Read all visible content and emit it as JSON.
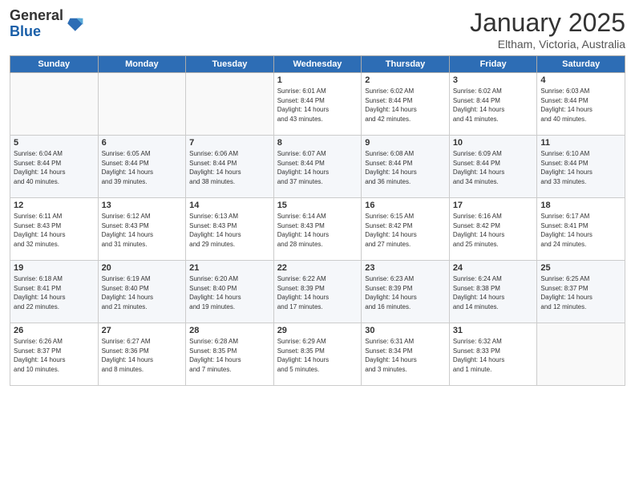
{
  "logo": {
    "general": "General",
    "blue": "Blue"
  },
  "header": {
    "month": "January 2025",
    "location": "Eltham, Victoria, Australia"
  },
  "weekdays": [
    "Sunday",
    "Monday",
    "Tuesday",
    "Wednesday",
    "Thursday",
    "Friday",
    "Saturday"
  ],
  "weeks": [
    [
      {
        "day": "",
        "info": ""
      },
      {
        "day": "",
        "info": ""
      },
      {
        "day": "",
        "info": ""
      },
      {
        "day": "1",
        "info": "Sunrise: 6:01 AM\nSunset: 8:44 PM\nDaylight: 14 hours\nand 43 minutes."
      },
      {
        "day": "2",
        "info": "Sunrise: 6:02 AM\nSunset: 8:44 PM\nDaylight: 14 hours\nand 42 minutes."
      },
      {
        "day": "3",
        "info": "Sunrise: 6:02 AM\nSunset: 8:44 PM\nDaylight: 14 hours\nand 41 minutes."
      },
      {
        "day": "4",
        "info": "Sunrise: 6:03 AM\nSunset: 8:44 PM\nDaylight: 14 hours\nand 40 minutes."
      }
    ],
    [
      {
        "day": "5",
        "info": "Sunrise: 6:04 AM\nSunset: 8:44 PM\nDaylight: 14 hours\nand 40 minutes."
      },
      {
        "day": "6",
        "info": "Sunrise: 6:05 AM\nSunset: 8:44 PM\nDaylight: 14 hours\nand 39 minutes."
      },
      {
        "day": "7",
        "info": "Sunrise: 6:06 AM\nSunset: 8:44 PM\nDaylight: 14 hours\nand 38 minutes."
      },
      {
        "day": "8",
        "info": "Sunrise: 6:07 AM\nSunset: 8:44 PM\nDaylight: 14 hours\nand 37 minutes."
      },
      {
        "day": "9",
        "info": "Sunrise: 6:08 AM\nSunset: 8:44 PM\nDaylight: 14 hours\nand 36 minutes."
      },
      {
        "day": "10",
        "info": "Sunrise: 6:09 AM\nSunset: 8:44 PM\nDaylight: 14 hours\nand 34 minutes."
      },
      {
        "day": "11",
        "info": "Sunrise: 6:10 AM\nSunset: 8:44 PM\nDaylight: 14 hours\nand 33 minutes."
      }
    ],
    [
      {
        "day": "12",
        "info": "Sunrise: 6:11 AM\nSunset: 8:43 PM\nDaylight: 14 hours\nand 32 minutes."
      },
      {
        "day": "13",
        "info": "Sunrise: 6:12 AM\nSunset: 8:43 PM\nDaylight: 14 hours\nand 31 minutes."
      },
      {
        "day": "14",
        "info": "Sunrise: 6:13 AM\nSunset: 8:43 PM\nDaylight: 14 hours\nand 29 minutes."
      },
      {
        "day": "15",
        "info": "Sunrise: 6:14 AM\nSunset: 8:43 PM\nDaylight: 14 hours\nand 28 minutes."
      },
      {
        "day": "16",
        "info": "Sunrise: 6:15 AM\nSunset: 8:42 PM\nDaylight: 14 hours\nand 27 minutes."
      },
      {
        "day": "17",
        "info": "Sunrise: 6:16 AM\nSunset: 8:42 PM\nDaylight: 14 hours\nand 25 minutes."
      },
      {
        "day": "18",
        "info": "Sunrise: 6:17 AM\nSunset: 8:41 PM\nDaylight: 14 hours\nand 24 minutes."
      }
    ],
    [
      {
        "day": "19",
        "info": "Sunrise: 6:18 AM\nSunset: 8:41 PM\nDaylight: 14 hours\nand 22 minutes."
      },
      {
        "day": "20",
        "info": "Sunrise: 6:19 AM\nSunset: 8:40 PM\nDaylight: 14 hours\nand 21 minutes."
      },
      {
        "day": "21",
        "info": "Sunrise: 6:20 AM\nSunset: 8:40 PM\nDaylight: 14 hours\nand 19 minutes."
      },
      {
        "day": "22",
        "info": "Sunrise: 6:22 AM\nSunset: 8:39 PM\nDaylight: 14 hours\nand 17 minutes."
      },
      {
        "day": "23",
        "info": "Sunrise: 6:23 AM\nSunset: 8:39 PM\nDaylight: 14 hours\nand 16 minutes."
      },
      {
        "day": "24",
        "info": "Sunrise: 6:24 AM\nSunset: 8:38 PM\nDaylight: 14 hours\nand 14 minutes."
      },
      {
        "day": "25",
        "info": "Sunrise: 6:25 AM\nSunset: 8:37 PM\nDaylight: 14 hours\nand 12 minutes."
      }
    ],
    [
      {
        "day": "26",
        "info": "Sunrise: 6:26 AM\nSunset: 8:37 PM\nDaylight: 14 hours\nand 10 minutes."
      },
      {
        "day": "27",
        "info": "Sunrise: 6:27 AM\nSunset: 8:36 PM\nDaylight: 14 hours\nand 8 minutes."
      },
      {
        "day": "28",
        "info": "Sunrise: 6:28 AM\nSunset: 8:35 PM\nDaylight: 14 hours\nand 7 minutes."
      },
      {
        "day": "29",
        "info": "Sunrise: 6:29 AM\nSunset: 8:35 PM\nDaylight: 14 hours\nand 5 minutes."
      },
      {
        "day": "30",
        "info": "Sunrise: 6:31 AM\nSunset: 8:34 PM\nDaylight: 14 hours\nand 3 minutes."
      },
      {
        "day": "31",
        "info": "Sunrise: 6:32 AM\nSunset: 8:33 PM\nDaylight: 14 hours\nand 1 minute."
      },
      {
        "day": "",
        "info": ""
      }
    ]
  ]
}
